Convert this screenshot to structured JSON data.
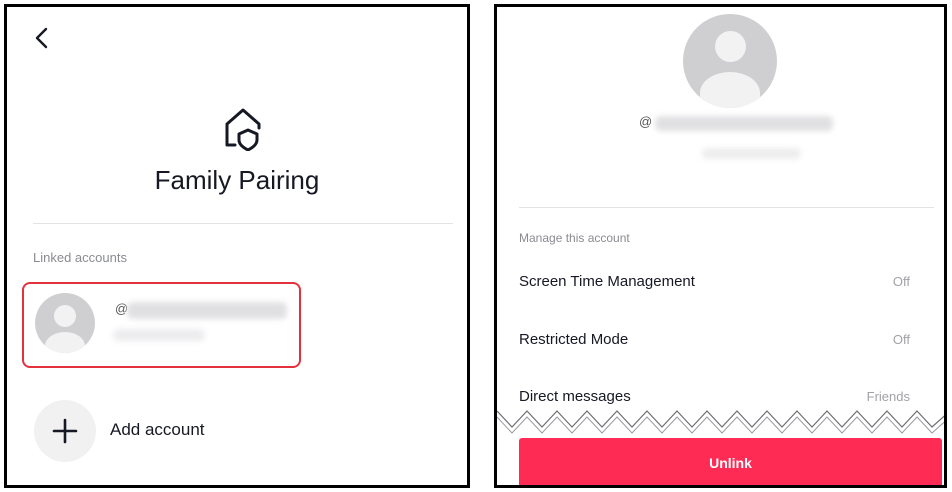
{
  "left_screen": {
    "back_icon": "chevron-left-icon",
    "header_icon": "home-shield-icon",
    "title": "Family Pairing",
    "section_label": "Linked accounts",
    "linked_account": {
      "avatar_icon": "default-avatar-icon",
      "at_symbol": "@"
    },
    "add_account": {
      "icon": "plus-icon",
      "label": "Add account"
    }
  },
  "right_screen": {
    "profile": {
      "avatar_icon": "default-avatar-icon",
      "at_symbol": "@"
    },
    "section_label": "Manage this account",
    "settings": [
      {
        "name": "Screen Time Management",
        "value": "Off"
      },
      {
        "name": "Restricted Mode",
        "value": "Off"
      },
      {
        "name": "Direct messages",
        "value": "Friends"
      }
    ],
    "unlink_label": "Unlink"
  },
  "colors": {
    "accent": "#fe2c55",
    "highlight_border": "#e4323d",
    "text_primary": "#161823",
    "text_secondary": "#8a8b91"
  }
}
